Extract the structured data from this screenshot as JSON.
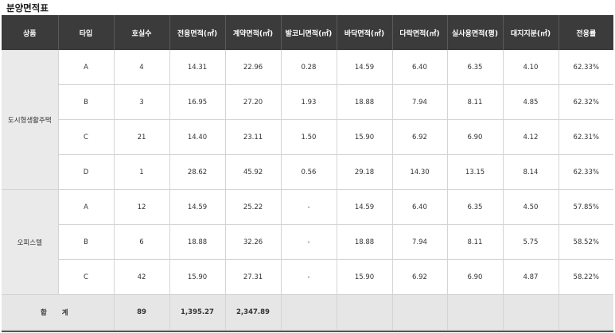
{
  "title": "분양면적표",
  "headers": [
    "상품",
    "타입",
    "호실수",
    "전용면적(㎡)",
    "계약면적(㎡)",
    "발코니면적(㎡)",
    "바닥면적(㎡)",
    "다락면적(㎡)",
    "실사용면적(평)",
    "대지지분(㎡)",
    "전용률"
  ],
  "groups": [
    {
      "name": "도시형생활주택",
      "rows": [
        [
          "A",
          "4",
          "14.31",
          "22.96",
          "0.28",
          "14.59",
          "6.40",
          "6.35",
          "4.10",
          "62.33%"
        ],
        [
          "B",
          "3",
          "16.95",
          "27.20",
          "1.93",
          "18.88",
          "7.94",
          "8.11",
          "4.85",
          "62.32%"
        ],
        [
          "C",
          "21",
          "14.40",
          "23.11",
          "1.50",
          "15.90",
          "6.92",
          "6.90",
          "4.12",
          "62.31%"
        ],
        [
          "D",
          "1",
          "28.62",
          "45.92",
          "0.56",
          "29.18",
          "14.30",
          "13.15",
          "8.14",
          "62.33%"
        ]
      ]
    },
    {
      "name": "오피스텔",
      "rows": [
        [
          "A",
          "12",
          "14.59",
          "25.22",
          "-",
          "14.59",
          "6.40",
          "6.35",
          "4.50",
          "57.85%"
        ],
        [
          "B",
          "6",
          "18.88",
          "32.26",
          "-",
          "18.88",
          "7.94",
          "8.11",
          "5.75",
          "58.52%"
        ],
        [
          "C",
          "42",
          "15.90",
          "27.31",
          "-",
          "15.90",
          "6.92",
          "6.90",
          "4.87",
          "58.22%"
        ]
      ]
    }
  ],
  "total": {
    "label": "합 계",
    "units": "89",
    "exclusive_area": "1,395.27",
    "contract_area": "2,347.89"
  }
}
